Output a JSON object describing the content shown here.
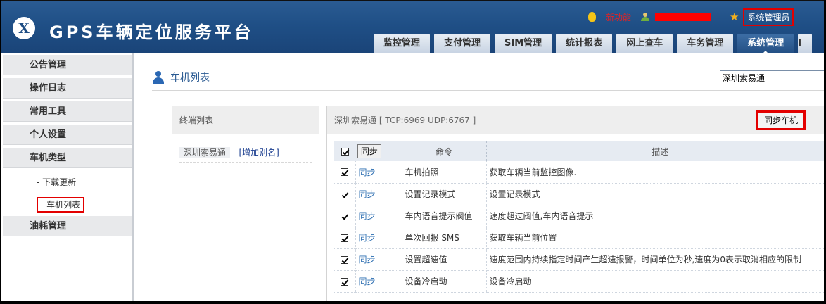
{
  "header": {
    "logo_mark": "X",
    "title": "GPS车辆定位服务平台",
    "new_function": "新功能",
    "admin": "系统管理员",
    "nav": [
      "监控管理",
      "支付管理",
      "SIM管理",
      "统计报表",
      "网上查车",
      "车务管理",
      "系统管理"
    ],
    "active_nav": "系统管理"
  },
  "sidebar": {
    "items": [
      {
        "label": "公告管理",
        "type": "section"
      },
      {
        "label": "操作日志",
        "type": "section"
      },
      {
        "label": "常用工具",
        "type": "section"
      },
      {
        "label": "个人设置",
        "type": "section"
      },
      {
        "label": "车机类型",
        "type": "section"
      },
      {
        "label": "- 下载更新",
        "type": "sub"
      },
      {
        "label": "- 车机列表",
        "type": "sub",
        "highlighted": true
      },
      {
        "label": "油耗管理",
        "type": "section"
      }
    ]
  },
  "main": {
    "page_title": "车机列表",
    "search_value": "深圳索易通",
    "terminal_panel": {
      "title": "终端列表",
      "row_name": "深圳索易通",
      "row_sep": " --",
      "row_link": "[增加别名]"
    },
    "command_panel": {
      "title": "深圳索易通 [ TCP:6969 UDP:6767 ]",
      "sync_all_label": "同步车机",
      "columns": {
        "sync_btn": "同步",
        "command": "命令",
        "description": "描述"
      },
      "rows": [
        {
          "sync": "同步",
          "command": "车机拍照",
          "description": "获取车辆当前监控图像."
        },
        {
          "sync": "同步",
          "command": "设置记录模式",
          "description": "设置记录模式"
        },
        {
          "sync": "同步",
          "command": "车内语音提示阀值",
          "description": "速度超过阀值,车内语音提示"
        },
        {
          "sync": "同步",
          "command": "单次回报 SMS",
          "description": "获取车辆当前位置"
        },
        {
          "sync": "同步",
          "command": "设置超速值",
          "description": "速度范围内持续指定时间产生超速报警，时间单位为秒,速度为0表示取消相应的限制"
        },
        {
          "sync": "同步",
          "command": "设备冷启动",
          "description": "设备冷启动"
        }
      ]
    }
  }
}
